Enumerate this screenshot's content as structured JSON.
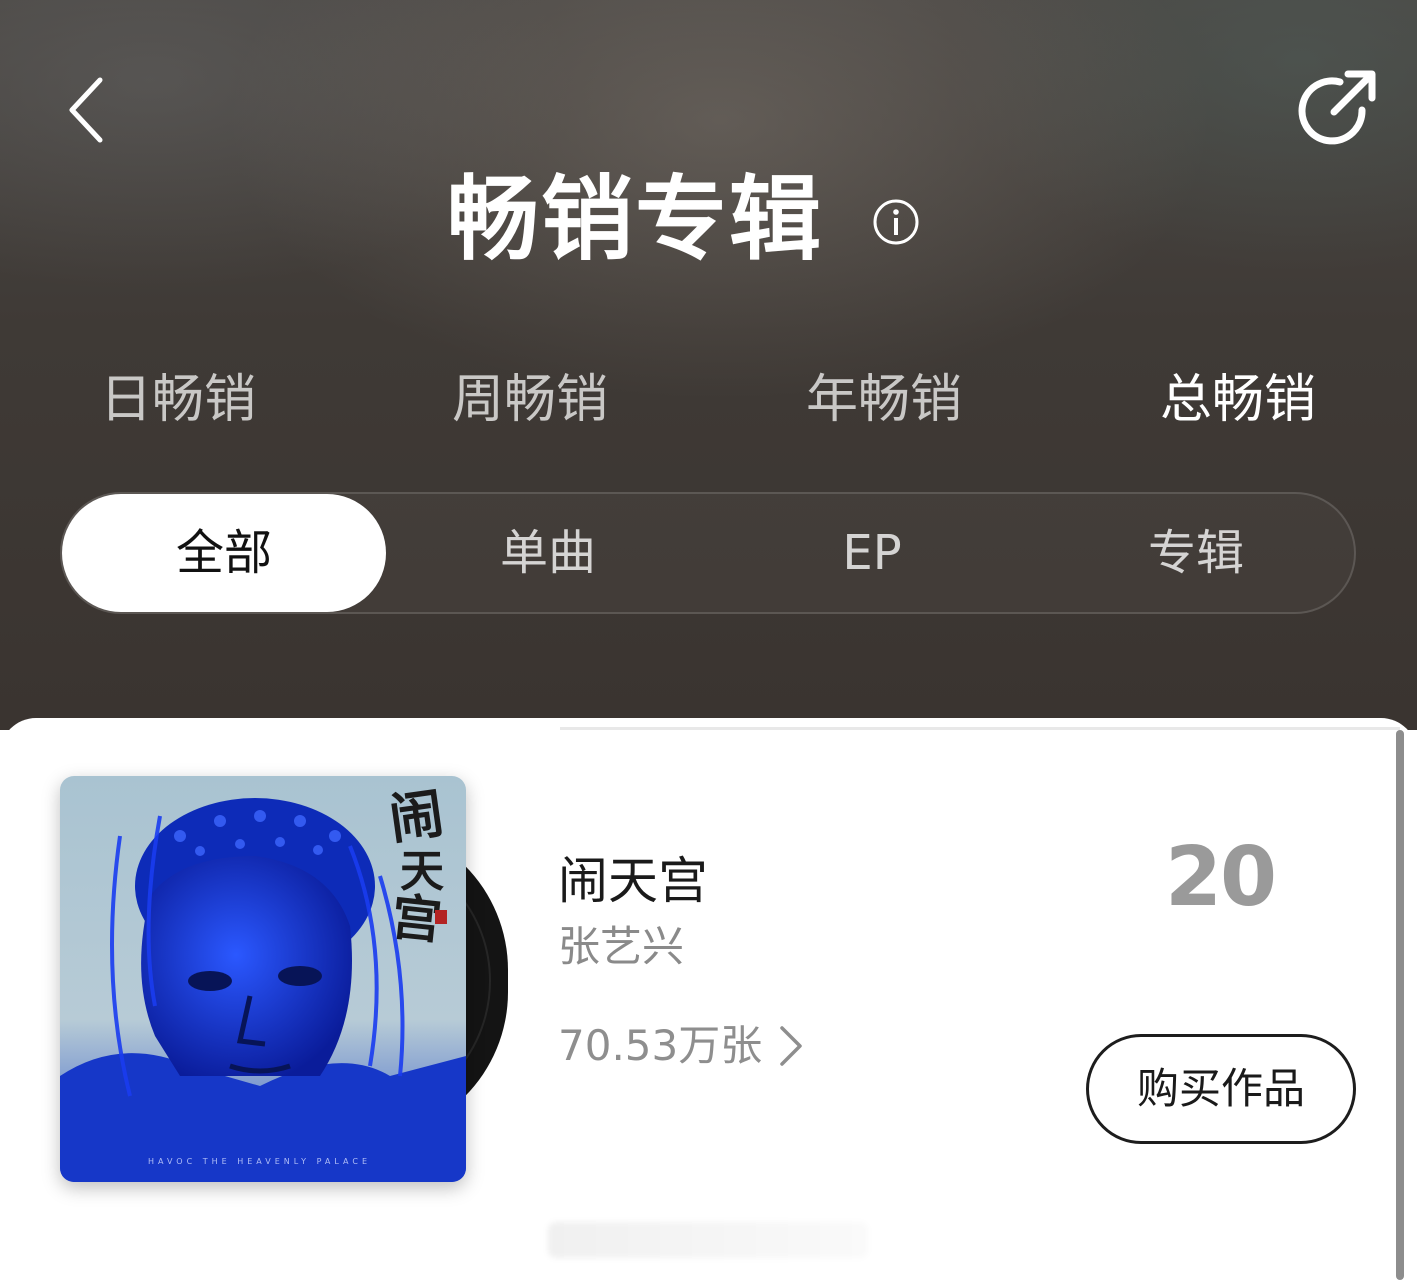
{
  "header": {
    "title": "畅销专辑",
    "back_icon": "chevron-left-icon",
    "share_icon": "share-icon",
    "info_icon": "info-icon"
  },
  "period_tabs": [
    {
      "label": "日畅销",
      "active": false
    },
    {
      "label": "周畅销",
      "active": false
    },
    {
      "label": "年畅销",
      "active": false
    },
    {
      "label": "总畅销",
      "active": true
    }
  ],
  "type_filters": [
    {
      "label": "全部",
      "active": true
    },
    {
      "label": "单曲",
      "active": false
    },
    {
      "label": "EP",
      "active": false
    },
    {
      "label": "专辑",
      "active": false
    }
  ],
  "album": {
    "title": "闹天宫",
    "artist": "张艺兴",
    "sales": "70.53万张",
    "rank": "20",
    "buy_label": "购买作品",
    "cover_calligraphy": "闹天宫",
    "cover_subtitle": "HAVOC THE HEAVENLY PALACE"
  },
  "colors": {
    "header_bg": "#3f3a36",
    "active_tab": "#ffffff",
    "rank": "#9a9a9a",
    "cover_blue": "#1f3fd8"
  }
}
